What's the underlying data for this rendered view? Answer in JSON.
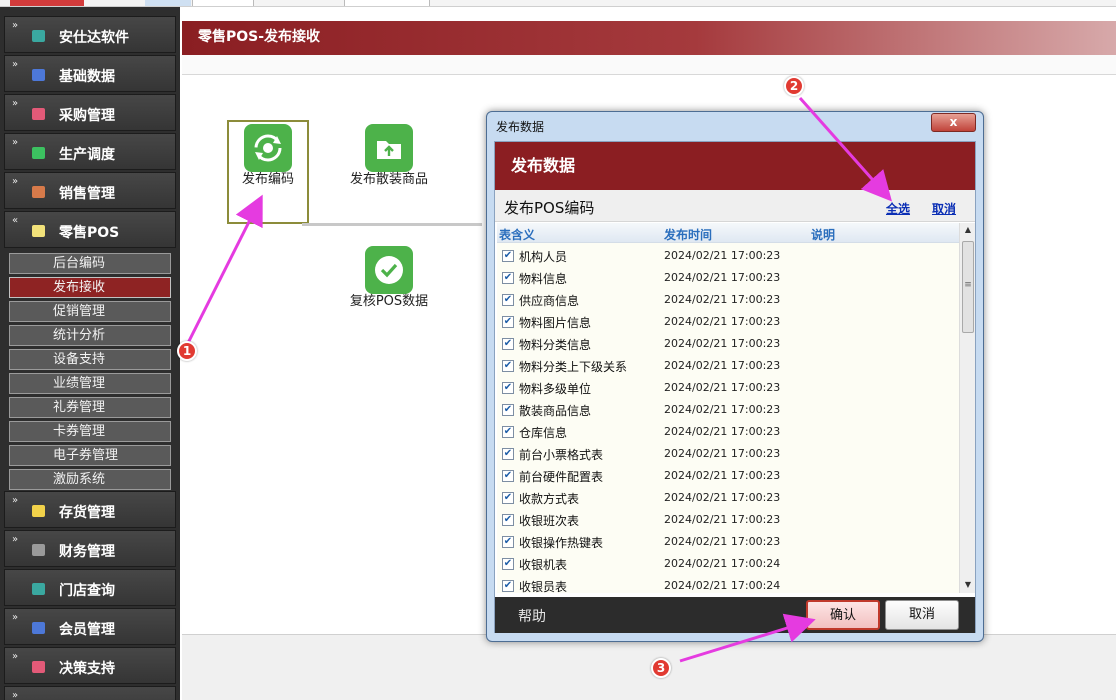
{
  "sidebar": {
    "menus": [
      {
        "label": "安仕达软件",
        "icon_color": "#3aa8a0"
      },
      {
        "label": "基础数据",
        "icon_color": "#4d78d8"
      },
      {
        "label": "采购管理",
        "icon_color": "#e35a78"
      },
      {
        "label": "生产调度",
        "icon_color": "#3cc160"
      },
      {
        "label": "销售管理",
        "icon_color": "#d77a4a"
      },
      {
        "label": "零售POS",
        "icon_color": "#f2e27a"
      },
      {
        "label": "存货管理",
        "icon_color": "#f2d24a"
      },
      {
        "label": "财务管理",
        "icon_color": "#9a9a9a"
      },
      {
        "label": "门店查询",
        "icon_color": "#3aa8a0"
      },
      {
        "label": "会员管理",
        "icon_color": "#4d78d8"
      },
      {
        "label": "决策支持",
        "icon_color": "#e35a78"
      }
    ],
    "submenu": [
      {
        "label": "后台编码"
      },
      {
        "label": "发布接收"
      },
      {
        "label": "促销管理"
      },
      {
        "label": "统计分析"
      },
      {
        "label": "设备支持"
      },
      {
        "label": "业绩管理"
      },
      {
        "label": "礼券管理"
      },
      {
        "label": "卡券管理"
      },
      {
        "label": "电子券管理"
      },
      {
        "label": "激励系统"
      }
    ]
  },
  "main": {
    "title": "零售POS-发布接收",
    "tiles": [
      {
        "label": "发布编码",
        "icon": "sync-icon"
      },
      {
        "label": "发布散装商品",
        "icon": "folder-upload-icon"
      },
      {
        "label": "复核POS数据",
        "icon": "check-icon"
      }
    ]
  },
  "dialog": {
    "window_title": "发布数据",
    "header": "发布数据",
    "subheader": "发布POS编码",
    "select_all": "全选",
    "cancel_link": "取消",
    "close_label": "x",
    "columns": [
      "表含义",
      "发布时间",
      "说明"
    ],
    "rows": [
      {
        "name": "机构人员",
        "time": "2024/02/21 17:00:23",
        "checked": true
      },
      {
        "name": "物料信息",
        "time": "2024/02/21 17:00:23",
        "checked": true
      },
      {
        "name": "供应商信息",
        "time": "2024/02/21 17:00:23",
        "checked": true
      },
      {
        "name": "物料图片信息",
        "time": "2024/02/21 17:00:23",
        "checked": true
      },
      {
        "name": "物料分类信息",
        "time": "2024/02/21 17:00:23",
        "checked": true
      },
      {
        "name": "物料分类上下级关系",
        "time": "2024/02/21 17:00:23",
        "checked": true
      },
      {
        "name": "物料多级单位",
        "time": "2024/02/21 17:00:23",
        "checked": true
      },
      {
        "name": "散装商品信息",
        "time": "2024/02/21 17:00:23",
        "checked": true
      },
      {
        "name": "仓库信息",
        "time": "2024/02/21 17:00:23",
        "checked": true
      },
      {
        "name": "前台小票格式表",
        "time": "2024/02/21 17:00:23",
        "checked": true
      },
      {
        "name": "前台硬件配置表",
        "time": "2024/02/21 17:00:23",
        "checked": true
      },
      {
        "name": "收款方式表",
        "time": "2024/02/21 17:00:23",
        "checked": true
      },
      {
        "name": "收银班次表",
        "time": "2024/02/21 17:00:23",
        "checked": true
      },
      {
        "name": "收银操作热键表",
        "time": "2024/02/21 17:00:23",
        "checked": true
      },
      {
        "name": "收银机表",
        "time": "2024/02/21 17:00:24",
        "checked": true
      },
      {
        "name": "收银员表",
        "time": "2024/02/21 17:00:24",
        "checked": true
      }
    ],
    "help": "帮助",
    "confirm": "确认",
    "cancel": "取消"
  },
  "annotations": {
    "step1": "1",
    "step2": "2",
    "step3": "3",
    "arrow_color": "#e53be0"
  }
}
